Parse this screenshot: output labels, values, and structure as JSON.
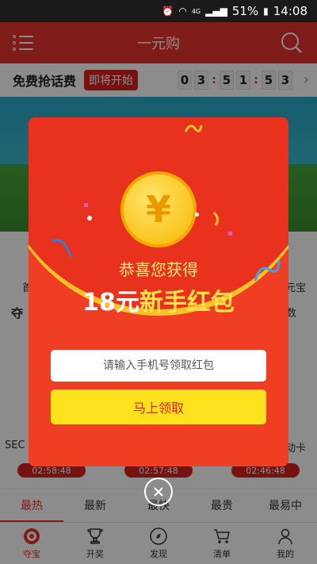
{
  "status_bar": {
    "net": "4G",
    "battery": "51%",
    "time": "14:08"
  },
  "header": {
    "title": "一元购"
  },
  "promo": {
    "title": "免费抢话费",
    "badge": "即将开始",
    "countdown": [
      "0",
      "3",
      "5",
      "1",
      "5",
      "3"
    ]
  },
  "background": {
    "row_start": "首",
    "row_end": "元宝",
    "item_left": "夺",
    "item_right": "数",
    "product_left": "SEC",
    "product_right": "动卡",
    "timers": [
      "02:58:48",
      "02:57:48",
      "02:46:48"
    ]
  },
  "sort_tabs": [
    "最热",
    "最新",
    "最快",
    "最贵",
    "最易中"
  ],
  "bottom_nav": [
    {
      "label": "夺宝",
      "icon": "target-icon",
      "active": true
    },
    {
      "label": "开奖",
      "icon": "trophy-icon",
      "active": false
    },
    {
      "label": "发现",
      "icon": "compass-icon",
      "active": false
    },
    {
      "label": "清单",
      "icon": "cart-icon",
      "active": false
    },
    {
      "label": "我的",
      "icon": "user-icon",
      "active": false
    }
  ],
  "modal": {
    "coin_symbol": "¥",
    "congrats": "恭喜您获得",
    "amount": "18元",
    "prize": "新手红包",
    "phone_placeholder": "请输入手机号领取红包",
    "claim_label": "马上领取"
  },
  "colors": {
    "brand_red": "#e8322c",
    "packet_red": "#f03e24",
    "gold": "#ffe21e"
  }
}
